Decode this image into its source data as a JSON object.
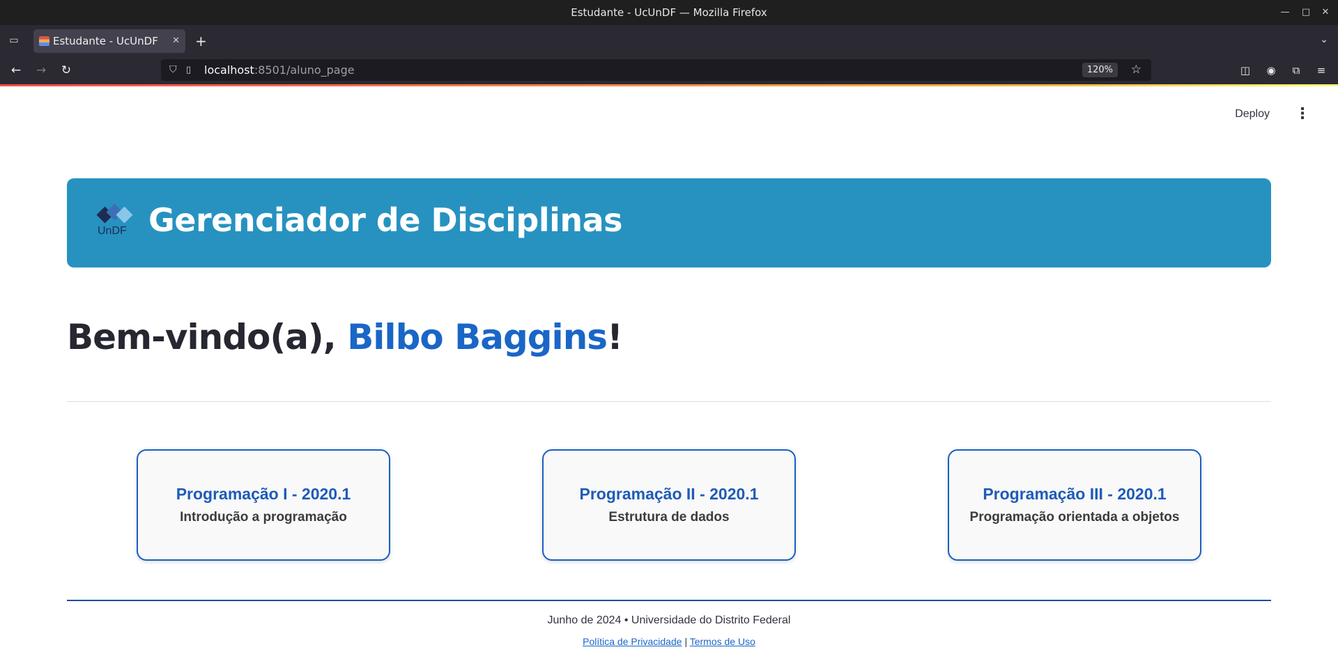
{
  "window": {
    "title": "Estudante - UcUnDF — Mozilla Firefox"
  },
  "browser": {
    "tab_title": "Estudante - UcUnDF",
    "url_host": "localhost",
    "url_rest": ":8501/aluno_page",
    "zoom": "120%"
  },
  "app": {
    "deploy_label": "Deploy",
    "banner_title": "Gerenciador de Disciplinas",
    "logo_text": "UnDF",
    "welcome_prefix": "Bem-vindo(a), ",
    "welcome_name": "Bilbo Baggins",
    "welcome_suffix": "!",
    "courses": [
      {
        "title": "Programação I - 2020.1",
        "subtitle": "Introdução a programação"
      },
      {
        "title": "Programação II - 2020.1",
        "subtitle": "Estrutura de dados"
      },
      {
        "title": "Programação III - 2020.1",
        "subtitle": "Programação orientada a objetos"
      }
    ],
    "footer": {
      "line": "Junho de 2024 • Universidade do Distrito Federal",
      "privacy": "Política de Privacidade",
      "separator": "|",
      "terms": "Termos de Uso"
    }
  },
  "colors": {
    "banner": "#2792c0",
    "accent": "#1a66c7",
    "card_border": "#1a5fc2"
  }
}
